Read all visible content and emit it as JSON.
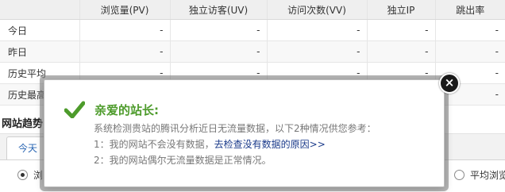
{
  "table": {
    "headers": [
      "",
      "浏览量(PV)",
      "独立访客(UV)",
      "访问次数(VV)",
      "独立IP",
      "跳出率"
    ],
    "rows": [
      {
        "label": "今日",
        "values": [
          "-",
          "-",
          "-",
          "-",
          "-"
        ]
      },
      {
        "label": "昨日",
        "values": [
          "-",
          "-",
          "-",
          "-",
          "-"
        ]
      },
      {
        "label": "历史平均",
        "values": [
          "-",
          "-",
          "-",
          "-",
          "-"
        ]
      },
      {
        "label": "历史最高",
        "values": [
          "-",
          "-",
          "-",
          "-",
          "-"
        ]
      }
    ]
  },
  "trend": {
    "title": "网站趋势",
    "tab_today": "今天",
    "radio_left_label": "浏",
    "radio_right_label": "平均浏览"
  },
  "modal": {
    "title": "亲爱的站长:",
    "intro": "系统检测贵站的腾讯分析近日无流量数据，以下2种情况供您参考：",
    "item1_prefix": "1：我的网站不会没有数据，",
    "item1_link": "去检查没有数据的原因>>",
    "item2": "2：我的网站偶尔无流量数据是正常情况。",
    "close_glyph": "×"
  },
  "colors": {
    "title_green": "#4d9b2b",
    "link_blue": "#1a3a8a"
  },
  "icons": {
    "check": "check-icon",
    "close": "close-icon"
  }
}
